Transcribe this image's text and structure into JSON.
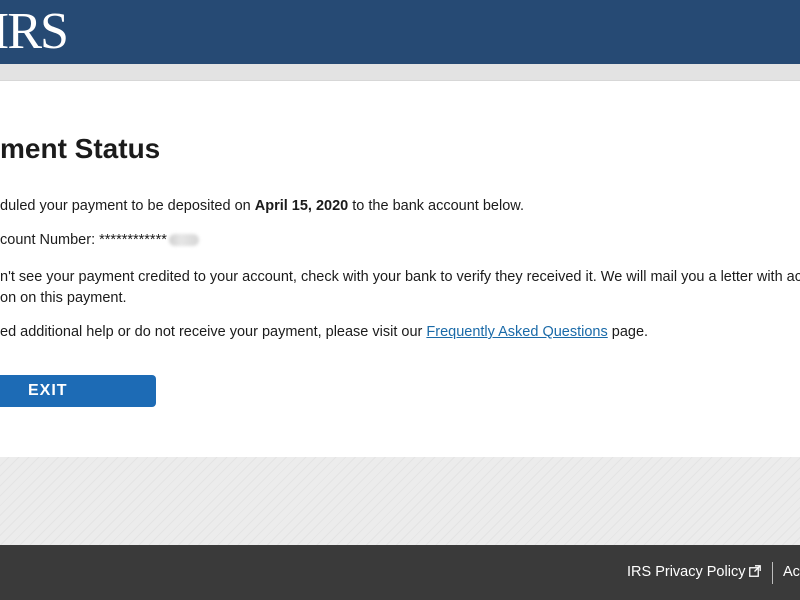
{
  "header": {
    "logo_text": "IRS"
  },
  "main": {
    "title": "Payment Status",
    "title_visible": "ment Status",
    "p1_start": "duled your payment to be deposited on ",
    "p1_date": "April 15, 2020",
    "p1_end": " to the bank account below.",
    "p2_label": "count Number: ",
    "p2_mask": "************",
    "p3_line1": "n't see your payment credited to your account, check with your bank to verify they received it. We will mail you a letter with ac",
    "p3_line2": "on on this payment.",
    "p4_start": "ed additional help or do not receive your payment, please visit our ",
    "p4_link": "Frequently Asked Questions",
    "p4_end": " page.",
    "exit_label": "EXIT"
  },
  "footer": {
    "privacy_label": "IRS Privacy Policy",
    "accessibility_label": "Ac"
  },
  "colors": {
    "header_bg": "#264a74",
    "button_bg": "#1d6bb5",
    "link": "#1a6aa8",
    "footer_bg": "#3a3a3a"
  },
  "icons": {
    "external_link": "external-link-icon"
  }
}
